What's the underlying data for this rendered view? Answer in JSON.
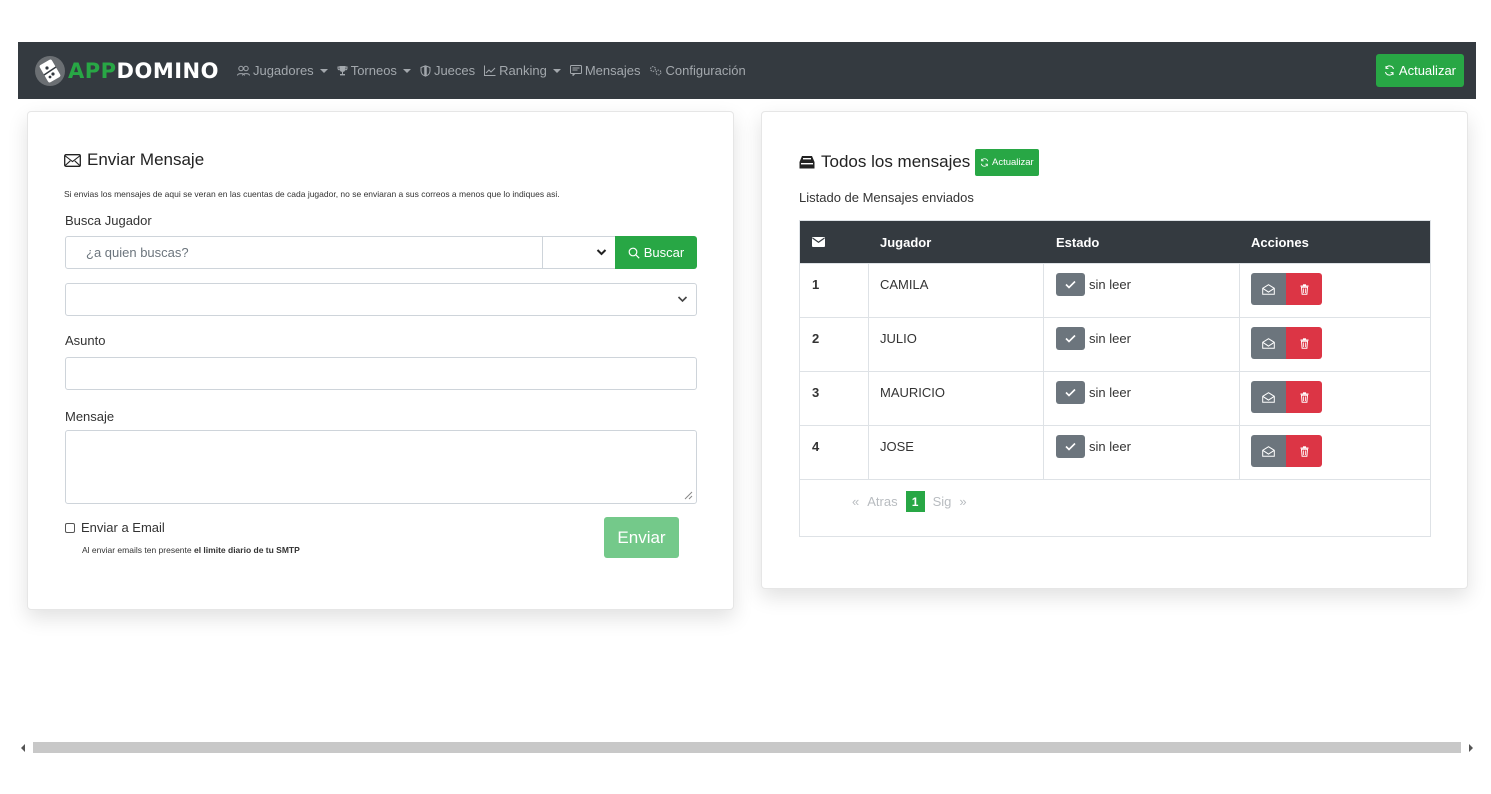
{
  "navbar": {
    "brand_app": "APP",
    "brand_domino": "DOMINO",
    "items": [
      {
        "label": "Jugadores",
        "icon": "users-icon",
        "dropdown": true
      },
      {
        "label": "Torneos",
        "icon": "trophy-icon",
        "dropdown": true
      },
      {
        "label": "Jueces",
        "icon": "shield-icon",
        "dropdown": false
      },
      {
        "label": "Ranking",
        "icon": "chart-line-icon",
        "dropdown": true
      },
      {
        "label": "Mensajes",
        "icon": "message-icon",
        "dropdown": false
      },
      {
        "label": "Configuración",
        "icon": "gears-icon",
        "dropdown": false
      }
    ],
    "update_label": "Actualizar"
  },
  "send_form": {
    "title": "Enviar Mensaje",
    "note": "Si envias los mensajes de aqui se veran en las cuentas de cada jugador, no se enviaran a sus correos a menos que lo indiques asi.",
    "search_label": "Busca Jugador",
    "search_placeholder": "¿a quien buscas?",
    "search_button": "Buscar",
    "subject_label": "Asunto",
    "subject_value": "",
    "message_label": "Mensaje",
    "message_value": "",
    "email_checkbox_label": "Enviar a Email",
    "email_checked": false,
    "smtp_note_prefix": "Al enviar emails ten presente ",
    "smtp_note_bold": "el limite diario de tu SMTP",
    "send_button": "Enviar"
  },
  "messages": {
    "title": "Todos los mensajes",
    "update_label": "Actualizar",
    "subtitle": "Listado de Mensajes enviados",
    "columns": [
      "",
      "Jugador",
      "Estado",
      "Acciones"
    ],
    "rows": [
      {
        "n": "1",
        "player": "CAMILA",
        "status": "sin leer"
      },
      {
        "n": "2",
        "player": "JULIO",
        "status": "sin leer"
      },
      {
        "n": "3",
        "player": "MAURICIO",
        "status": "sin leer"
      },
      {
        "n": "4",
        "player": "JOSE",
        "status": "sin leer"
      }
    ],
    "pager": {
      "first": "«",
      "prev": "Atras",
      "current": "1",
      "next": "Sig",
      "last": "»"
    }
  },
  "colors": {
    "navbar": "#343a40",
    "success": "#28a745",
    "danger": "#dc3545",
    "secondary": "#6c757d"
  }
}
